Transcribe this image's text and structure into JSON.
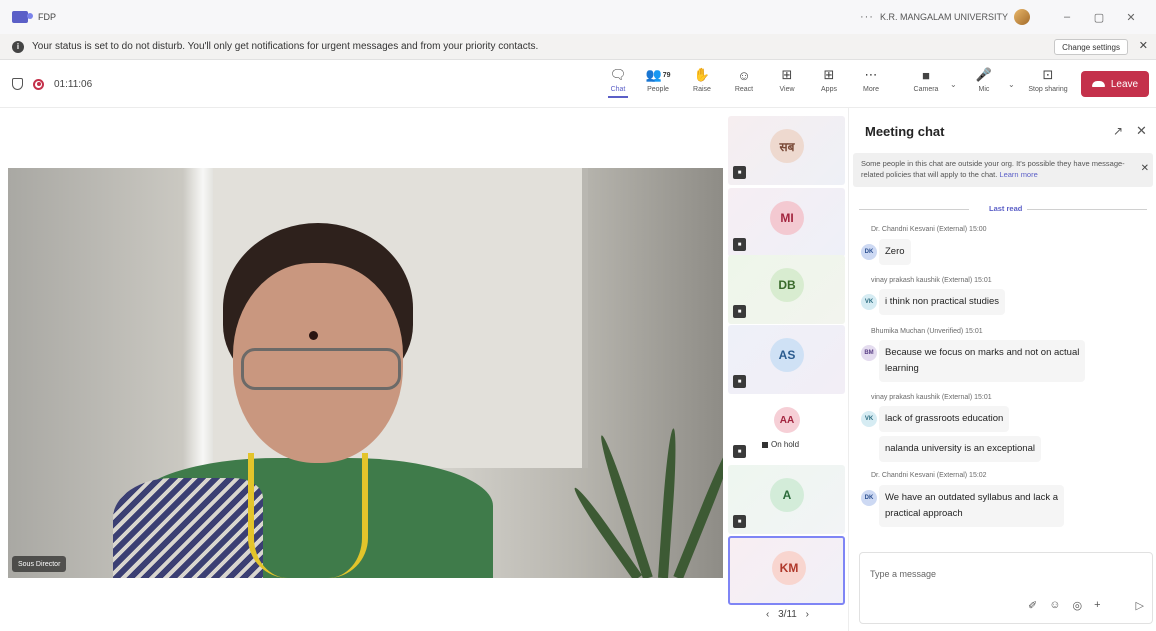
{
  "window": {
    "app_title": "FDP",
    "ellipsis": "···",
    "org_name": "K.R. MANGALAM UNIVERSITY",
    "minimize": "–",
    "maximize": "▢",
    "close": "✕"
  },
  "notification": {
    "text": "Your status is set to do not disturb. You'll only get notifications for urgent messages and from your priority contacts.",
    "button": "Change settings",
    "close": "✕"
  },
  "meeting": {
    "timer": "01:11:06"
  },
  "toolbar": {
    "chat": "Chat",
    "people": "People",
    "people_count": "79",
    "raise": "Raise",
    "react": "React",
    "view": "View",
    "apps": "Apps",
    "more": "More",
    "camera": "Camera",
    "mic": "Mic",
    "stop_sharing": "Stop sharing",
    "leave": "Leave"
  },
  "stage": {
    "presenter_name": "Sous Director"
  },
  "participants": [
    {
      "initials": "सब",
      "bg": "#eed9cf",
      "fg": "#7a4a38"
    },
    {
      "initials": "MI",
      "bg": "#f3c9d1",
      "fg": "#a3253f"
    },
    {
      "initials": "DB",
      "bg": "#d8ecd0",
      "fg": "#3a6b2c"
    },
    {
      "initials": "AS",
      "bg": "#cfe1f5",
      "fg": "#2b5c8f"
    },
    {
      "initials": "AA",
      "bg": "#f6cfd6",
      "fg": "#a3253f",
      "status": "On hold"
    },
    {
      "initials": "A",
      "bg": "#d3ecd9",
      "fg": "#2c6b3b"
    },
    {
      "initials": "KM",
      "bg": "#f8d5cf",
      "fg": "#b0382a"
    }
  ],
  "pager": "3/11",
  "chat": {
    "title": "Meeting chat",
    "banner": "Some people in this chat are outside your org. It's possible they have message-related policies that will apply to the chat.",
    "banner_link": "Learn more",
    "last_read": "Last read",
    "messages": [
      {
        "meta": "Dr. Chandni Kesvani (External)  15:00",
        "initials": "DK",
        "text": "Zero"
      },
      {
        "meta": "vinay prakash kaushik (External)  15:01",
        "initials": "VK",
        "text": "i think non practical studies"
      },
      {
        "meta": "Bhumika Muchan (Unverified)  15:01",
        "initials": "BM",
        "text1": "Because we focus on marks and not on actual",
        "text2": "learning"
      },
      {
        "meta": "vinay prakash kaushik (External)  15:01",
        "initials": "VK",
        "text": "lack of grassroots education",
        "text_b": "nalanda university is an exceptional"
      },
      {
        "meta": "Dr. Chandni Kesvani (External)  15:02",
        "initials": "DK",
        "text1": "We have an outdated syllabus and lack a",
        "text2": "practical approach"
      }
    ],
    "compose_placeholder": "Type a message"
  },
  "colors": {
    "accent": "#5b5fc7",
    "leave": "#c4314b"
  }
}
